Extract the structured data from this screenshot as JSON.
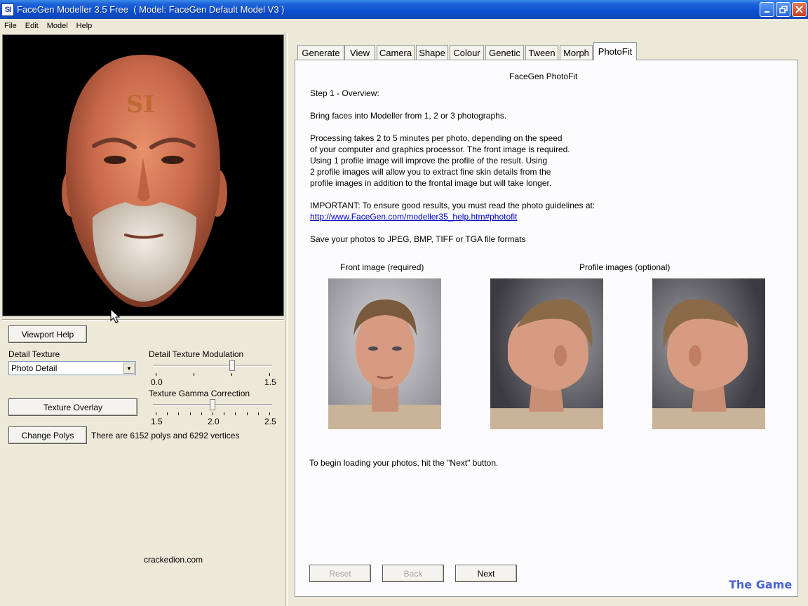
{
  "window": {
    "icon_text": "SI",
    "title": "FaceGen Modeller 3.5 Free  ( Model: FaceGen Default Model V3 )",
    "controls": [
      "minimize-icon",
      "restore-icon",
      "close-icon"
    ]
  },
  "menu": {
    "items": [
      {
        "label": "File"
      },
      {
        "label": "Edit"
      },
      {
        "label": "Model"
      },
      {
        "label": "Help"
      }
    ]
  },
  "viewport": {
    "forehead_stamp": "SI"
  },
  "left_panel": {
    "viewport_help": "Viewport Help",
    "detail_texture_label": "Detail Texture",
    "detail_texture_value": "Photo Detail",
    "modulation_label": "Detail Texture Modulation",
    "modulation": {
      "min": "0.0",
      "max": "1.5",
      "value_fraction": 0.67
    },
    "texture_overlay": "Texture Overlay",
    "gamma_label": "Texture Gamma Correction",
    "gamma": {
      "min": "1.5",
      "mid": "2.0",
      "max": "2.5",
      "value_fraction": 0.5
    },
    "change_polys": "Change Polys",
    "poly_info": "There are 6152 polys and 6292 vertices",
    "site_text": "crackedion.com"
  },
  "tabs": [
    {
      "label": "Generate"
    },
    {
      "label": "View"
    },
    {
      "label": "Camera"
    },
    {
      "label": "Shape"
    },
    {
      "label": "Colour"
    },
    {
      "label": "Genetic"
    },
    {
      "label": "Tween"
    },
    {
      "label": "Morph"
    },
    {
      "label": "PhotoFit",
      "active": true
    }
  ],
  "photofit": {
    "heading": "FaceGen PhotoFit",
    "step": "Step 1 - Overview:",
    "intro": "Bring faces into Modeller from 1, 2 or 3 photographs.",
    "processing": [
      "Processing takes 2 to 5 minutes per photo, depending on the speed",
      "of your computer and graphics processor. The front image is required.",
      "Using 1 profile image will improve the profile of the result. Using",
      "2 profile images will allow you to extract fine skin details from the",
      "profile images in addition to the frontal image but will take longer."
    ],
    "important": "IMPORTANT: To ensure good results, you must read the photo guidelines at:",
    "link": "http://www.FaceGen.com/modeller35_help.htm#photofit",
    "formats": "Save your photos to JPEG, BMP, TIFF or TGA file formats",
    "front_label": "Front image (required)",
    "profile_label": "Profile images (optional)",
    "begin": "To begin loading your photos, hit the \"Next\" button.",
    "buttons": {
      "reset": "Reset",
      "back": "Back",
      "next": "Next"
    }
  },
  "watermark": "The Game",
  "colors": {
    "titlebar": "#0a4fd0",
    "face_background": "#121212",
    "link": "#0000cc",
    "watermark": "#4a64d6"
  }
}
